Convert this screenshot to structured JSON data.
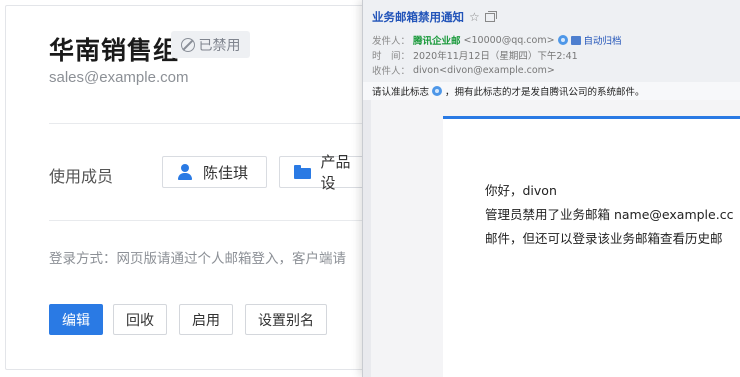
{
  "group": {
    "title": "华南销售组",
    "status": "已禁用",
    "email": "sales@example.com"
  },
  "members": {
    "label": "使用成员",
    "person": "陈佳琪",
    "department": "产品设"
  },
  "login": {
    "text": "登录方式：网页版请通过个人邮箱登入，客户端请"
  },
  "actions": {
    "edit": "编辑",
    "recall": "回收",
    "enable": "启用",
    "alias": "设置别名"
  },
  "mail": {
    "subject": "业务邮箱禁用通知",
    "star_icon": "☆",
    "sender_label": "发件人：",
    "sender_name": "腾讯企业邮",
    "sender_address": "<10000@qq.com>",
    "archive_label": "自动归档",
    "time_label": "时　间：",
    "time_value": "2020年11月12日（星期四）下午2:41",
    "recipient_label": "收件人：",
    "recipient_value": "divon<divon@example.com>",
    "notice_prefix": "请认准此标志",
    "notice_suffix": "，拥有此标志的才是发自腾讯公司的系统邮件。",
    "body_greeting": "你好，divon",
    "body_line1": "管理员禁用了业务邮箱 name@example.cc",
    "body_line2": "邮件，但还可以登录该业务邮箱查看历史邮"
  },
  "colors": {
    "accent": "#2a7ae4",
    "sender_green": "#1b9a3c",
    "link_blue": "#2254b9"
  }
}
